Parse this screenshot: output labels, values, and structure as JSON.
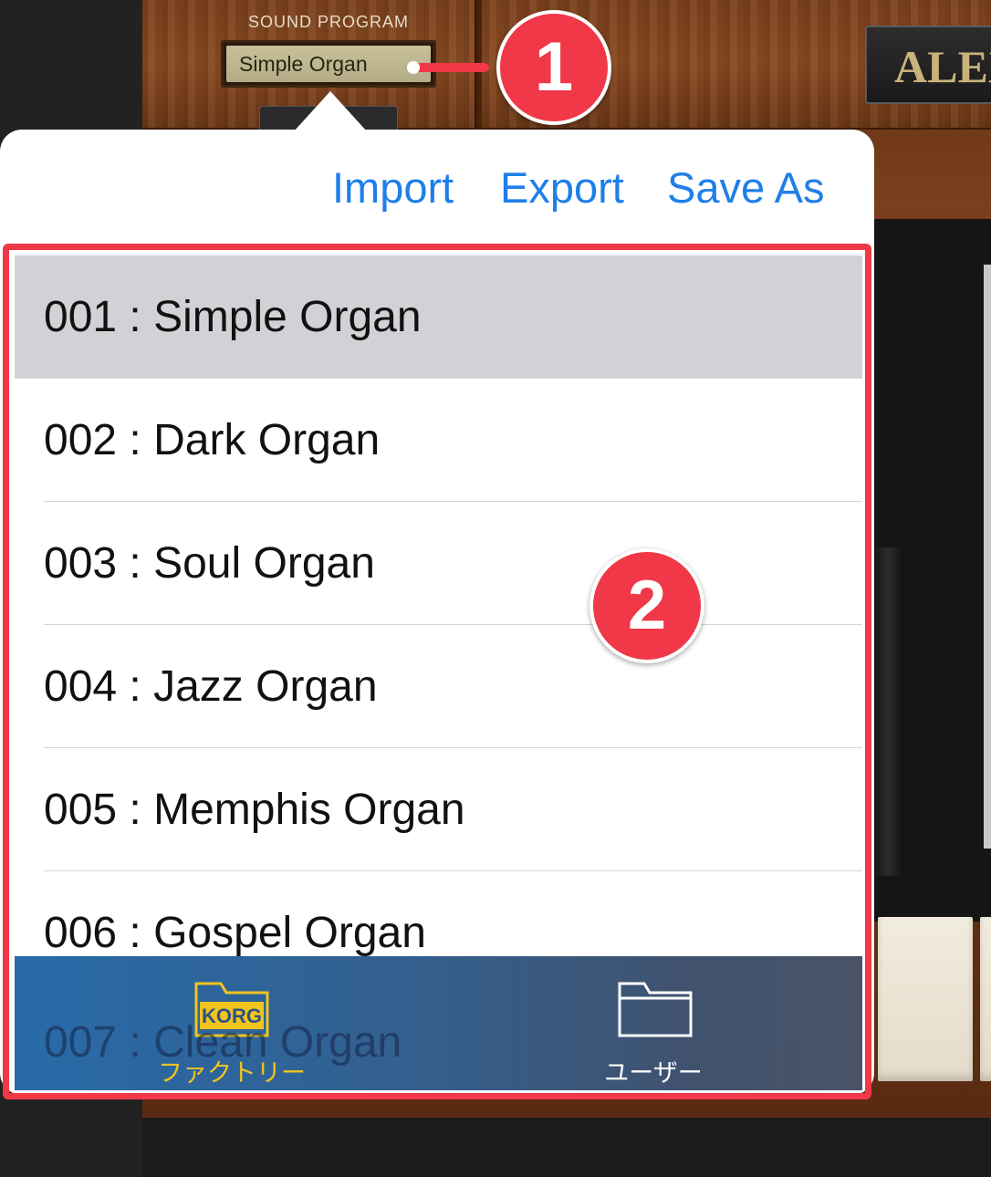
{
  "app": {
    "sound_program_label": "SOUND PROGRAM",
    "current_program": "Simple Organ",
    "brand": "ALEX"
  },
  "popover": {
    "toolbar": {
      "import_label": "Import",
      "export_label": "Export",
      "save_as_label": "Save As"
    },
    "programs": [
      "001 : Simple Organ",
      "002 : Dark Organ",
      "003 : Soul Organ",
      "004 : Jazz Organ",
      "005 : Memphis Organ",
      "006 : Gospel Organ",
      "007 : Clean Organ"
    ],
    "selected_index": 0,
    "tabs": {
      "factory": {
        "label": "ファクトリー",
        "icon": "korg-folder-icon",
        "badge": "KORG",
        "color": "#f1c417"
      },
      "user": {
        "label": "ユーザー",
        "icon": "folder-icon",
        "color": "#ffffff"
      }
    }
  },
  "annotations": {
    "callout_1": "1",
    "callout_2": "2",
    "color": "#f03848"
  }
}
